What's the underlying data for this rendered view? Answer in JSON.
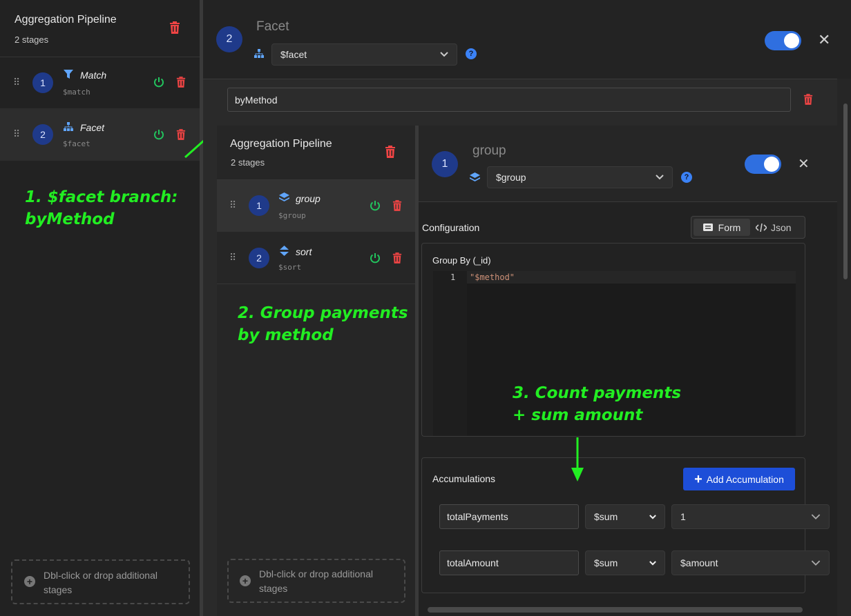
{
  "left": {
    "title": "Aggregation Pipeline",
    "subtitle": "2 stages",
    "stages": [
      {
        "num": "1",
        "name": "Match",
        "op": "$match"
      },
      {
        "num": "2",
        "name": "Facet",
        "op": "$facet"
      }
    ],
    "dropzone": "Dbl-click or drop additional stages"
  },
  "annotations": {
    "note1_line1": "1. $facet branch:",
    "note1_line2": "byMethod",
    "note2_line1": "2. Group payments",
    "note2_line2": "by method",
    "note3_line1": "3. Count payments",
    "note3_line2": "+ sum amount"
  },
  "facet_stage": {
    "num": "2",
    "title": "Facet",
    "operator": "$facet",
    "branch_name": "byMethod"
  },
  "inner": {
    "title": "Aggregation Pipeline",
    "subtitle": "2 stages",
    "stages": [
      {
        "num": "1",
        "name": "group",
        "op": "$group"
      },
      {
        "num": "2",
        "name": "sort",
        "op": "$sort"
      }
    ],
    "dropzone": "Dbl-click or drop additional stages"
  },
  "group_stage": {
    "num": "1",
    "title": "group",
    "operator": "$group",
    "config_label": "Configuration",
    "tab_form": "Form",
    "tab_json": "Json",
    "group_by_label": "Group By (_id)",
    "code_line_no": "1",
    "code_text": "\"$method\"",
    "accum_label": "Accumulations",
    "add_accum": "Add Accumulation",
    "accumulations": [
      {
        "field": "totalPayments",
        "op": "$sum",
        "value": "1"
      },
      {
        "field": "totalAmount",
        "op": "$sum",
        "value": "$amount"
      }
    ]
  }
}
